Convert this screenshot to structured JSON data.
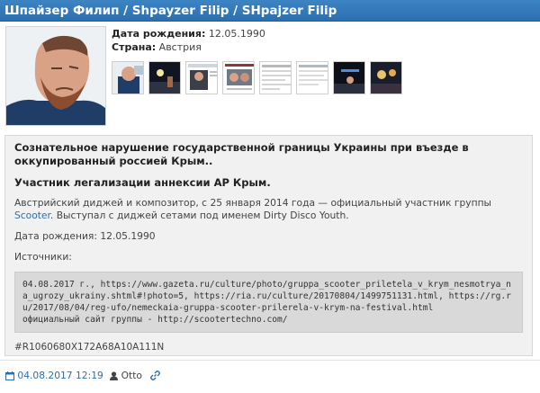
{
  "header": {
    "title": "Шпайзер Филип / Shpayzer Filip / SHpajzer Filip"
  },
  "profile": {
    "birth_label": "Дата рождения:",
    "birth_value": "12.05.1990",
    "country_label": "Страна:",
    "country_value": "Австрия"
  },
  "thumbnails": [
    {
      "name": "photo-1"
    },
    {
      "name": "photo-2"
    },
    {
      "name": "photo-3"
    },
    {
      "name": "photo-4"
    },
    {
      "name": "photo-5"
    },
    {
      "name": "photo-6"
    },
    {
      "name": "photo-7"
    },
    {
      "name": "photo-8"
    }
  ],
  "content": {
    "lead": "Сознательное нарушение государственной границы Украины при въезде в оккупированный россией Крым..",
    "sub_lead": "Участник легализации аннексии АР Крым.",
    "desc_before": "Австрийский диджей и композитор, с 25 января 2014 года — официальный участник группы ",
    "desc_link": "Scooter",
    "desc_after": ".  Выступал с диджей сетами под именем Dirty Disco Youth.",
    "birth_line": "Дата рождения:  12.05.1990",
    "sources_label": "Источники:",
    "sources_text": "04.08.2017 г., https://www.gazeta.ru/culture/photo/gruppa_scooter_priletela_v_krym_nesmotrya_na_ugrozy_ukrainy.shtml#!photo=5, https://ria.ru/culture/20170804/1499751131.html, https://rg.ru/2017/08/04/reg-ufo/nemeckaia-gruppa-scooter-prilerela-v-krym-na-festival.html",
    "sources_site": "официальный сайт группы - http://scootertechno.com/",
    "hash": "#R1060680X172A68A10A111N"
  },
  "footer": {
    "date": "04.08.2017 12:19",
    "author": "Otto"
  },
  "colors": {
    "header_bg": "#2c6fae",
    "link": "#2c6fae",
    "content_bg": "#f1f1f1",
    "sources_bg": "#d9d9d9"
  }
}
